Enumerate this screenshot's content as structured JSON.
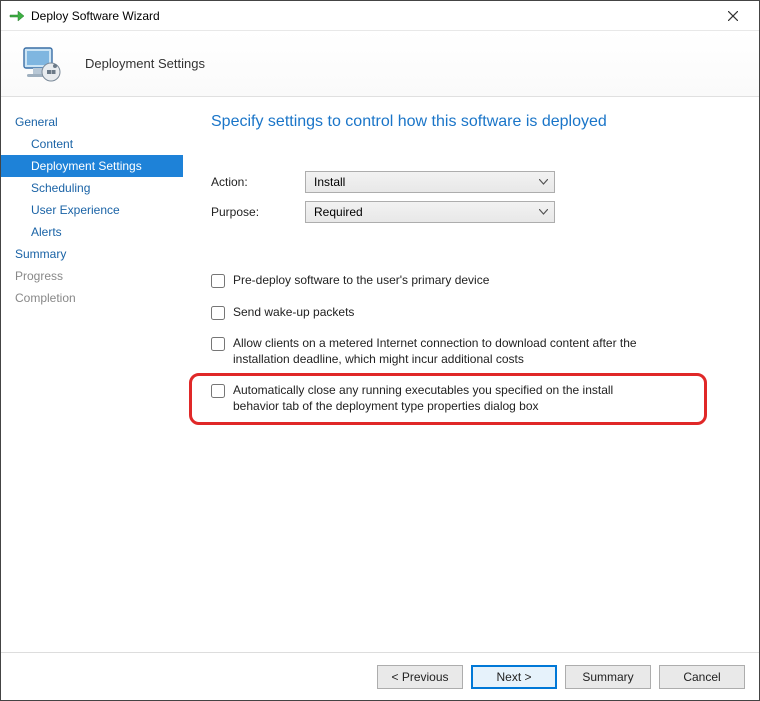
{
  "window": {
    "title": "Deploy Software Wizard"
  },
  "header": {
    "subtitle": "Deployment Settings"
  },
  "sidebar": {
    "items": [
      {
        "label": "General",
        "sub": false,
        "active": false,
        "disabled": false
      },
      {
        "label": "Content",
        "sub": true,
        "active": false,
        "disabled": false
      },
      {
        "label": "Deployment Settings",
        "sub": true,
        "active": true,
        "disabled": false
      },
      {
        "label": "Scheduling",
        "sub": true,
        "active": false,
        "disabled": false
      },
      {
        "label": "User Experience",
        "sub": true,
        "active": false,
        "disabled": false
      },
      {
        "label": "Alerts",
        "sub": true,
        "active": false,
        "disabled": false
      },
      {
        "label": "Summary",
        "sub": false,
        "active": false,
        "disabled": false
      },
      {
        "label": "Progress",
        "sub": false,
        "active": false,
        "disabled": true
      },
      {
        "label": "Completion",
        "sub": false,
        "active": false,
        "disabled": true
      }
    ]
  },
  "page": {
    "title": "Specify settings to control how this software is deployed",
    "action_label": "Action:",
    "action_value": "Install",
    "purpose_label": "Purpose:",
    "purpose_value": "Required",
    "checkboxes": [
      {
        "label": "Pre-deploy software to the user's primary device",
        "checked": false
      },
      {
        "label": "Send wake-up packets",
        "checked": false
      },
      {
        "label": "Allow clients on a metered Internet connection to download content after the installation deadline, which might incur additional costs",
        "checked": false
      },
      {
        "label": "Automatically close any running executables you specified on the install behavior tab of the deployment type properties dialog box",
        "checked": false
      }
    ]
  },
  "footer": {
    "previous": "< Previous",
    "next": "Next >",
    "summary": "Summary",
    "cancel": "Cancel"
  }
}
